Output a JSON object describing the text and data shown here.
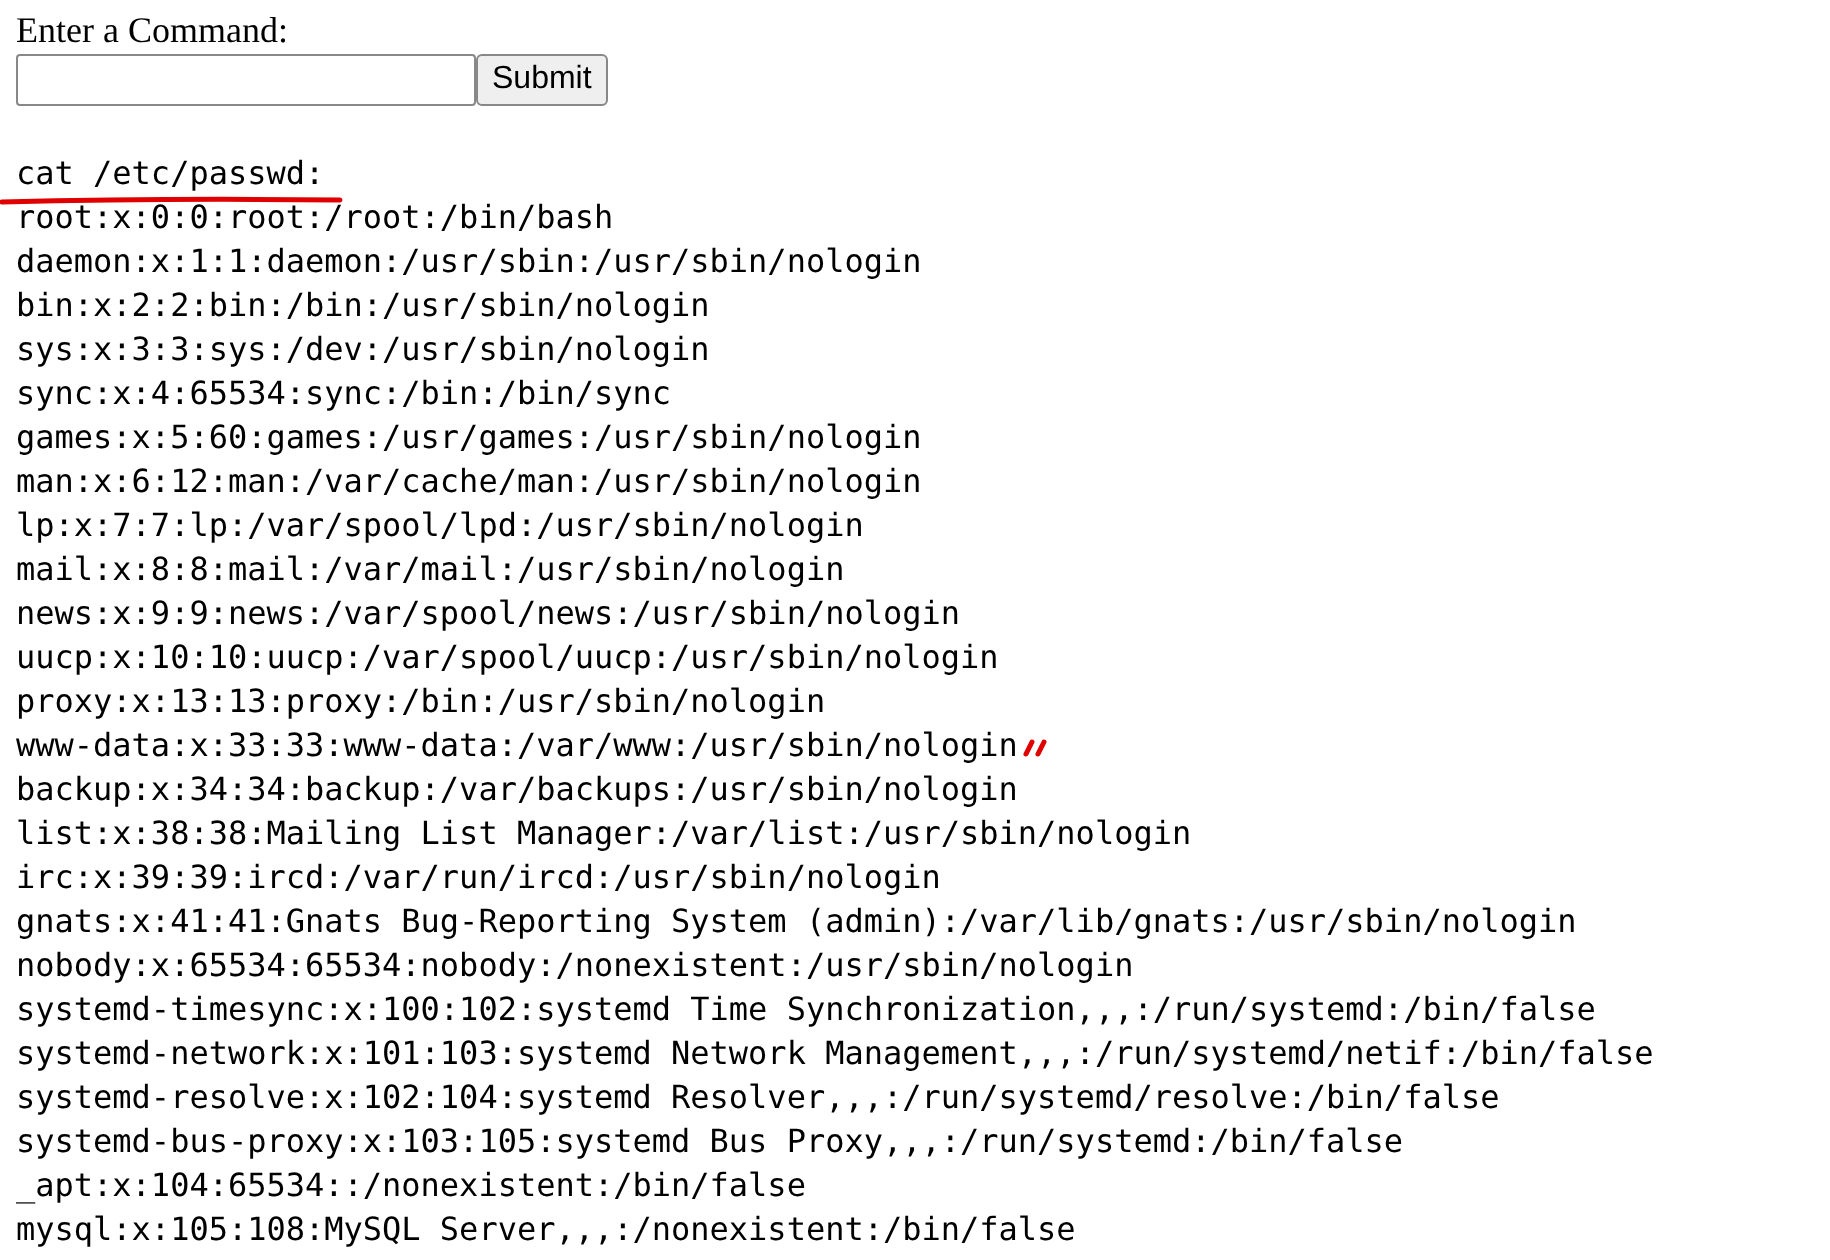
{
  "form": {
    "label": "Enter a Command:",
    "submit": "Submit"
  },
  "output": {
    "command": "cat /etc/passwd:",
    "underlined": true,
    "lines": [
      {
        "text": "root:x:0:0:root:/root:/bin/bash",
        "marked": false
      },
      {
        "text": "daemon:x:1:1:daemon:/usr/sbin:/usr/sbin/nologin",
        "marked": false
      },
      {
        "text": "bin:x:2:2:bin:/bin:/usr/sbin/nologin",
        "marked": false
      },
      {
        "text": "sys:x:3:3:sys:/dev:/usr/sbin/nologin",
        "marked": false
      },
      {
        "text": "sync:x:4:65534:sync:/bin:/bin/sync",
        "marked": false
      },
      {
        "text": "games:x:5:60:games:/usr/games:/usr/sbin/nologin",
        "marked": false
      },
      {
        "text": "man:x:6:12:man:/var/cache/man:/usr/sbin/nologin",
        "marked": false
      },
      {
        "text": "lp:x:7:7:lp:/var/spool/lpd:/usr/sbin/nologin",
        "marked": false
      },
      {
        "text": "mail:x:8:8:mail:/var/mail:/usr/sbin/nologin",
        "marked": false
      },
      {
        "text": "news:x:9:9:news:/var/spool/news:/usr/sbin/nologin",
        "marked": false
      },
      {
        "text": "uucp:x:10:10:uucp:/var/spool/uucp:/usr/sbin/nologin",
        "marked": false
      },
      {
        "text": "proxy:x:13:13:proxy:/bin:/usr/sbin/nologin",
        "marked": false
      },
      {
        "text": "www-data:x:33:33:www-data:/var/www:/usr/sbin/nologin",
        "marked": true
      },
      {
        "text": "backup:x:34:34:backup:/var/backups:/usr/sbin/nologin",
        "marked": false
      },
      {
        "text": "list:x:38:38:Mailing List Manager:/var/list:/usr/sbin/nologin",
        "marked": false
      },
      {
        "text": "irc:x:39:39:ircd:/var/run/ircd:/usr/sbin/nologin",
        "marked": false
      },
      {
        "text": "gnats:x:41:41:Gnats Bug-Reporting System (admin):/var/lib/gnats:/usr/sbin/nologin",
        "marked": false
      },
      {
        "text": "nobody:x:65534:65534:nobody:/nonexistent:/usr/sbin/nologin",
        "marked": false
      },
      {
        "text": "systemd-timesync:x:100:102:systemd Time Synchronization,,,:/run/systemd:/bin/false",
        "marked": false
      },
      {
        "text": "systemd-network:x:101:103:systemd Network Management,,,:/run/systemd/netif:/bin/false",
        "marked": false
      },
      {
        "text": "systemd-resolve:x:102:104:systemd Resolver,,,:/run/systemd/resolve:/bin/false",
        "marked": false
      },
      {
        "text": "systemd-bus-proxy:x:103:105:systemd Bus Proxy,,,:/run/systemd:/bin/false",
        "marked": false
      },
      {
        "text": "_apt:x:104:65534::/nonexistent:/bin/false",
        "marked": false
      },
      {
        "text": "mysql:x:105:108:MySQL Server,,,:/nonexistent:/bin/false",
        "marked": false
      }
    ]
  }
}
